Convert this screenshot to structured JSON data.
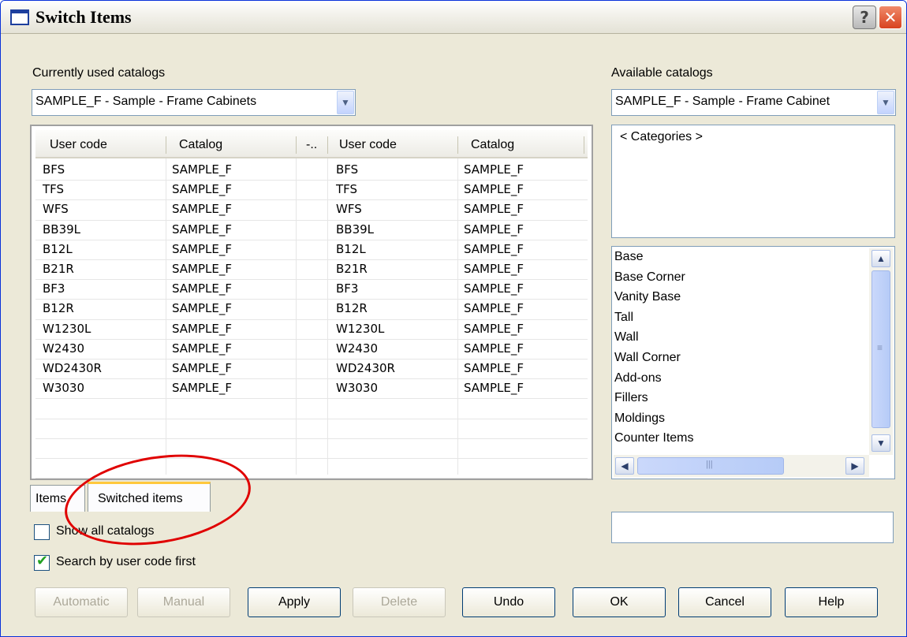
{
  "window": {
    "title": "Switch Items",
    "help_symbol": "?",
    "close_symbol": "✕"
  },
  "left": {
    "label": "Currently used catalogs",
    "combo_value": "SAMPLE_F - Sample - Frame Cabinets",
    "headers": [
      "User code",
      "Catalog",
      "-..",
      "User code",
      "Catalog"
    ],
    "rows": [
      [
        "BFS",
        "SAMPLE_F",
        "BFS",
        "SAMPLE_F"
      ],
      [
        "TFS",
        "SAMPLE_F",
        "TFS",
        "SAMPLE_F"
      ],
      [
        "WFS",
        "SAMPLE_F",
        "WFS",
        "SAMPLE_F"
      ],
      [
        "BB39L",
        "SAMPLE_F",
        "BB39L",
        "SAMPLE_F"
      ],
      [
        "B12L",
        "SAMPLE_F",
        "B12L",
        "SAMPLE_F"
      ],
      [
        "B21R",
        "SAMPLE_F",
        "B21R",
        "SAMPLE_F"
      ],
      [
        "BF3",
        "SAMPLE_F",
        "BF3",
        "SAMPLE_F"
      ],
      [
        "B12R",
        "SAMPLE_F",
        "B12R",
        "SAMPLE_F"
      ],
      [
        "W1230L",
        "SAMPLE_F",
        "W1230L",
        "SAMPLE_F"
      ],
      [
        "W2430",
        "SAMPLE_F",
        "W2430",
        "SAMPLE_F"
      ],
      [
        "WD2430R",
        "SAMPLE_F",
        "WD2430R",
        "SAMPLE_F"
      ],
      [
        "W3030",
        "SAMPLE_F",
        "W3030",
        "SAMPLE_F"
      ]
    ],
    "tabs": {
      "items": "Items",
      "switched": "Switched items"
    },
    "checkboxes": {
      "show_all": {
        "label": "Show all catalogs",
        "checked": false
      },
      "search_first": {
        "label": "Search by user code first",
        "checked": true
      }
    }
  },
  "right": {
    "label": "Available catalogs",
    "combo_value": "SAMPLE_F - Sample - Frame Cabinet",
    "categories_root": "< Categories >",
    "categories": [
      "Base",
      "Base Corner",
      "Vanity Base",
      "Tall",
      "Wall",
      "Wall Corner",
      "Add-ons",
      "Fillers",
      "Moldings",
      "Counter Items"
    ]
  },
  "buttons": {
    "automatic": "Automatic",
    "manual": "Manual",
    "apply": "Apply",
    "delete": "Delete",
    "undo": "Undo",
    "ok": "OK",
    "cancel": "Cancel",
    "help": "Help"
  },
  "colors": {
    "dialog_bg": "#ece9d8",
    "title_border": "#0831d9",
    "annotation_red": "#e00000",
    "active_tab_accent": "#ffc83c"
  }
}
